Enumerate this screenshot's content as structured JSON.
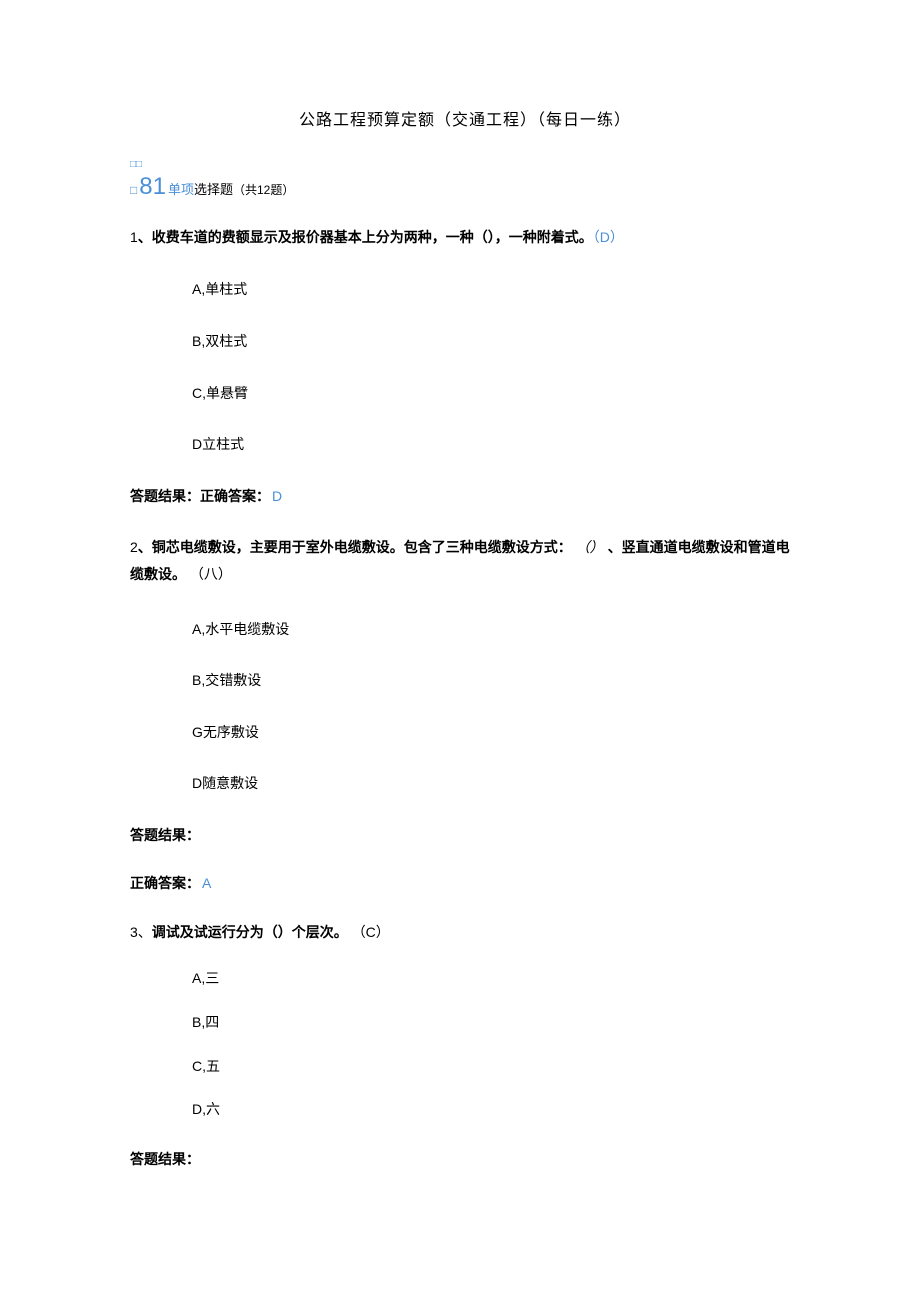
{
  "title": "公路工程预算定额（交通工程）（每日一练）",
  "markerRow1": "□□",
  "markerBox": "□",
  "big81": "81",
  "sectionPrefix": "单项",
  "sectionLabel": "选择题",
  "countText": "（共12题）",
  "q1": {
    "num": "1",
    "sep": "、",
    "text": "收费车道的费额显示及报价器基本上分为两种，一种（），一种附着式。",
    "hint": "（D）",
    "options": {
      "a": {
        "letter": "A,",
        "text": "单柱式"
      },
      "b": {
        "letter": "B,",
        "text": "双柱式"
      },
      "c": {
        "letter": "C,",
        "text": "单悬臂"
      },
      "d": {
        "letter": "D",
        "text": "立柱式"
      }
    },
    "resultLabel": "答题结果：正确答案：",
    "answer": "D"
  },
  "q2": {
    "num": "2",
    "sep": "、",
    "text1": "铜芯电缆敷设，主要用于室外电缆敷设。包含了三种电缆敷设方式：",
    "blank": "（）",
    "text2": "、竖直通道电缆敷设和管道电缆敷设。",
    "hint": "（八）",
    "options": {
      "a": {
        "letter": "A,",
        "text": "水平电缆敷设"
      },
      "b": {
        "letter": "B,",
        "text": "交错敷设"
      },
      "c": {
        "letter": "G",
        "text": "无序敷设"
      },
      "d": {
        "letter": "D",
        "text": "随意敷设"
      }
    },
    "resultLabel": "答题结果：",
    "correctLabel": "正确答案：",
    "answer": "A"
  },
  "q3": {
    "num": "3",
    "sep": "、",
    "text": "调试及试运行分为（）个层次。",
    "hint": "（C）",
    "options": {
      "a": {
        "letter": "A,",
        "text": "三"
      },
      "b": {
        "letter": "B,",
        "text": "四"
      },
      "c": {
        "letter": "C,",
        "text": "五"
      },
      "d": {
        "letter": "D,",
        "text": "六"
      }
    },
    "resultLabel": "答题结果："
  }
}
